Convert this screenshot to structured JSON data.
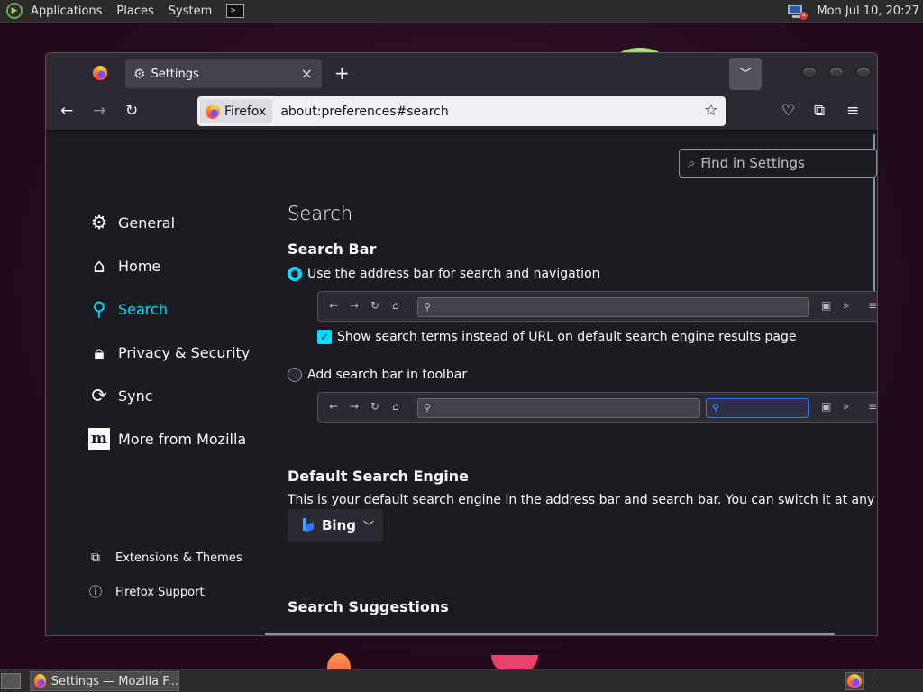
{
  "top_panel": {
    "menu": [
      "Applications",
      "Places",
      "System"
    ],
    "clock": "Mon Jul 10, 20:27"
  },
  "taskbar": {
    "window_title": "Settings — Mozilla F..."
  },
  "browser": {
    "tab_title": "Settings",
    "tab_close": "×",
    "new_tab": "+",
    "identity_label": "Firefox",
    "url": "about:preferences#search",
    "find_placeholder": "Find in Settings"
  },
  "sidebar": {
    "items": [
      {
        "label": "General",
        "icon": "gear-icon"
      },
      {
        "label": "Home",
        "icon": "home-icon"
      },
      {
        "label": "Search",
        "icon": "search-icon",
        "active": true
      },
      {
        "label": "Privacy & Security",
        "icon": "lock-icon"
      },
      {
        "label": "Sync",
        "icon": "sync-icon"
      },
      {
        "label": "More from Mozilla",
        "icon": "mozilla-logo-icon"
      }
    ],
    "bottom": [
      {
        "label": "Extensions & Themes",
        "icon": "puzzle-icon"
      },
      {
        "label": "Firefox Support",
        "icon": "help-icon"
      }
    ]
  },
  "main": {
    "title": "Search",
    "search_bar": {
      "heading": "Search Bar",
      "option_address": "Use the address bar for search and navigation",
      "option_address_selected": true,
      "show_terms": "Show search terms instead of URL on default search engine results page",
      "show_terms_checked": true,
      "option_toolbar": "Add search bar in toolbar",
      "option_toolbar_selected": false
    },
    "default_engine": {
      "heading": "Default Search Engine",
      "description": "This is your default search engine in the address bar and search bar. You can switch it at any time.",
      "engine": "Bing"
    },
    "suggestions_heading": "Search Suggestions"
  },
  "colors": {
    "accent": "#00ddff",
    "content_bg": "#1c1b22",
    "toolbar_bg": "#2b2a33"
  }
}
